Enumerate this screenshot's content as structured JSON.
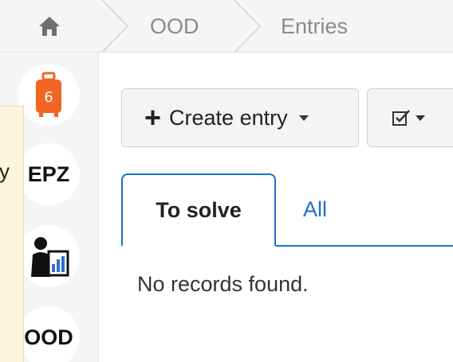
{
  "breadcrumb": {
    "home_icon": "home-icon",
    "items": [
      "OOD",
      "Entries"
    ]
  },
  "rail": {
    "items": [
      {
        "name": "luggage-app",
        "icon": "luggage-icon",
        "label": ""
      },
      {
        "name": "epz-app",
        "icon": "",
        "label": "EPZ"
      },
      {
        "name": "presenter-app",
        "icon": "presenter-chart-icon",
        "label": ""
      },
      {
        "name": "ood-app",
        "icon": "",
        "label": "OOD"
      }
    ]
  },
  "tooltip": {
    "visible_text": "y"
  },
  "toolbar": {
    "create_label": "Create entry",
    "create_icon": "plus-icon",
    "check_icon": "checkbox-icon"
  },
  "tabs": [
    {
      "label": "To solve",
      "active": true
    },
    {
      "label": "All",
      "active": false
    }
  ],
  "table": {
    "empty_message": "No records found."
  },
  "colors": {
    "accent": "#1a73c7",
    "luggage": "#f26522",
    "tooltip_bg": "#fcf7dc"
  }
}
